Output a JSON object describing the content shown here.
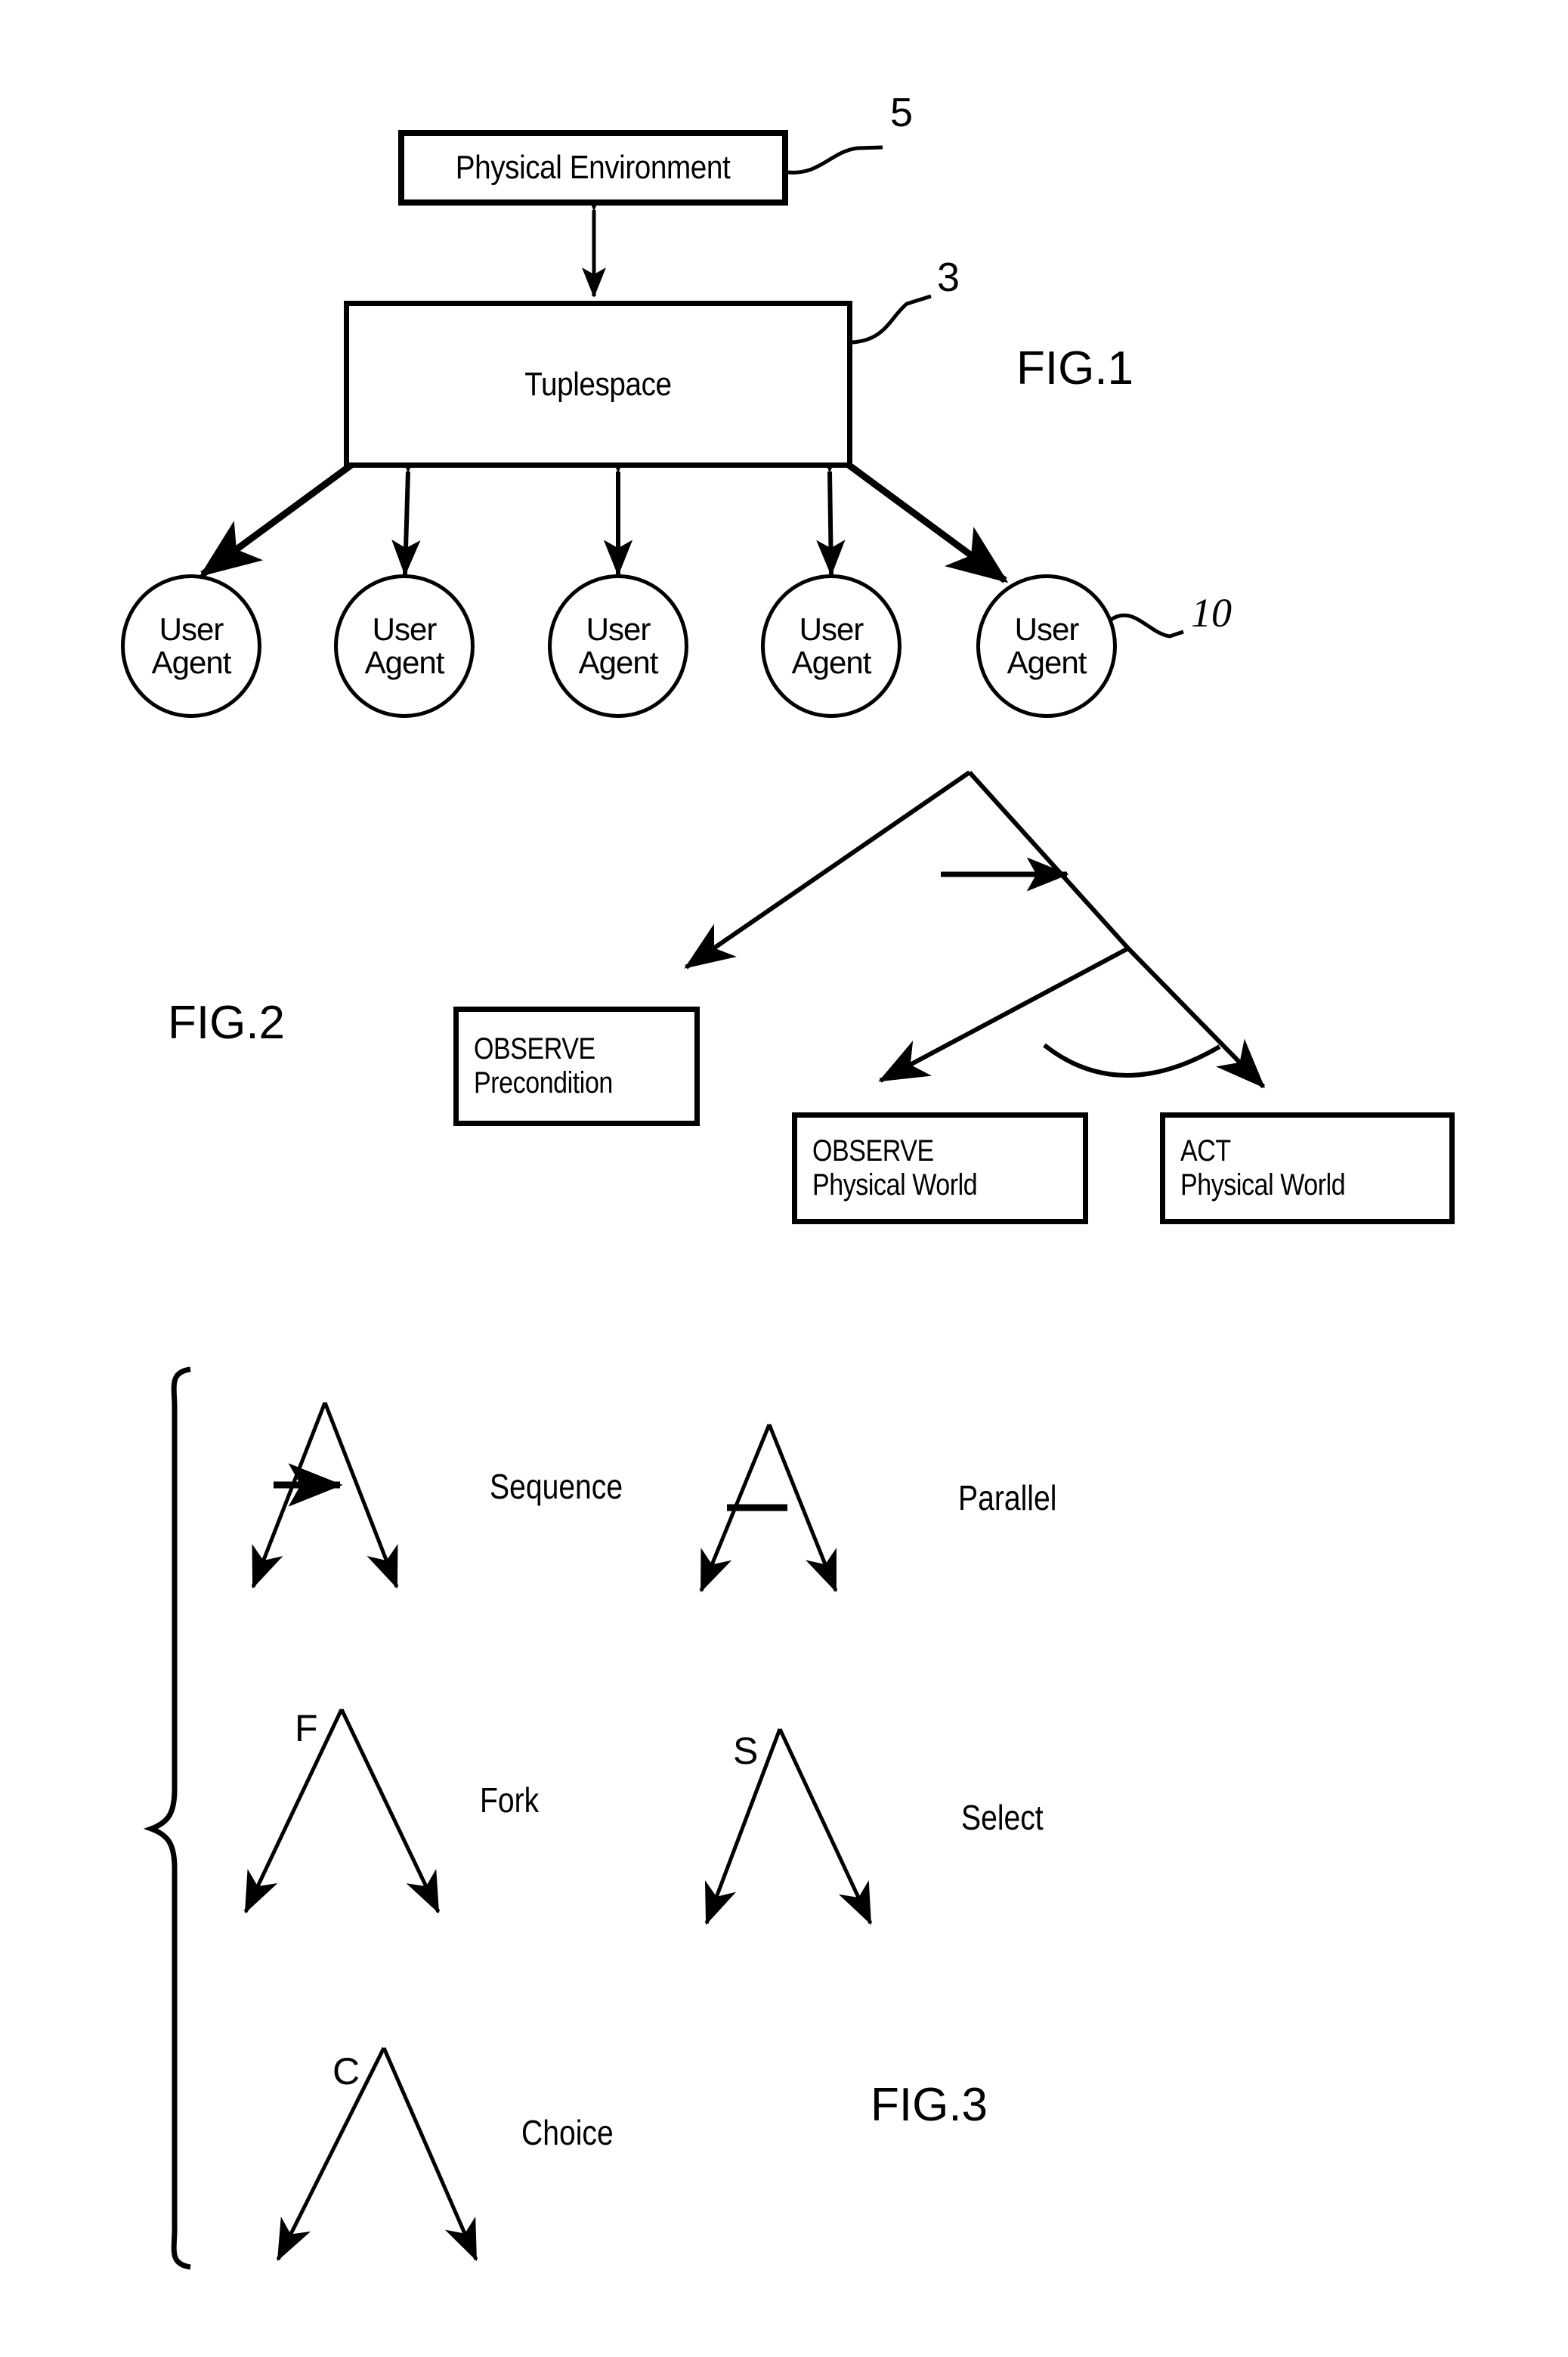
{
  "document": {
    "type": "patent-drawing-sheet",
    "background_color": "#ffffff",
    "ink_color": "#000000"
  },
  "fig1": {
    "label": "FIG.1",
    "physical_environment": {
      "text": "Physical Environment",
      "ref": "5"
    },
    "tuplespace": {
      "text": "Tuplespace",
      "ref": "3"
    },
    "agent_ref": "10",
    "agents": [
      {
        "line1": "User",
        "line2": "Agent"
      },
      {
        "line1": "User",
        "line2": "Agent"
      },
      {
        "line1": "User",
        "line2": "Agent"
      },
      {
        "line1": "User",
        "line2": "Agent"
      },
      {
        "line1": "User",
        "line2": "Agent"
      }
    ]
  },
  "fig2": {
    "label": "FIG.2",
    "boxes": [
      {
        "line1": "OBSERVE",
        "line2": "Precondition"
      },
      {
        "line1": "OBSERVE",
        "line2": "Physical World"
      },
      {
        "line1": "ACT",
        "line2": "Physical World"
      }
    ]
  },
  "fig3": {
    "label": "FIG.3",
    "symbols": [
      {
        "letter": "",
        "name": "Sequence",
        "marker": "arrow"
      },
      {
        "letter": "",
        "name": "Parallel",
        "marker": "bar"
      },
      {
        "letter": "F",
        "name": "Fork",
        "marker": "none"
      },
      {
        "letter": "S",
        "name": "Select",
        "marker": "none"
      },
      {
        "letter": "C",
        "name": "Choice",
        "marker": "none"
      }
    ]
  }
}
